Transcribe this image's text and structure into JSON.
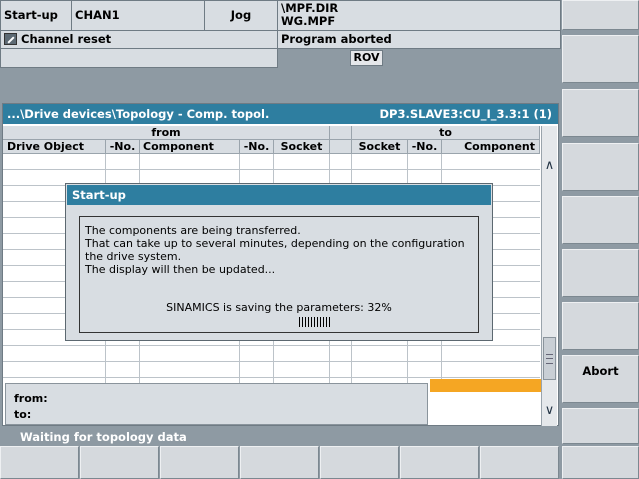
{
  "header": {
    "mode": "Start-up",
    "channel": "CHAN1",
    "op_mode": "Jog",
    "program_path": "\\MPF.DIR",
    "program_name": "WG.MPF",
    "channel_status": "Channel reset",
    "program_status": "Program aborted",
    "rov_label": "ROV"
  },
  "window": {
    "title": "...\\Drive devices\\Topology - Comp. topol.",
    "device": "DP3.SLAVE3:CU_I_3.3:1 (1)"
  },
  "table": {
    "group_from": "from",
    "group_to": "to",
    "columns": [
      "Drive Object",
      "-No.",
      "Component",
      "-No.",
      "Socket",
      "",
      "Socket",
      "-No.",
      "Component"
    ],
    "from_label": "from:",
    "to_label": "to:"
  },
  "dialog": {
    "title": "Start-up",
    "lines": [
      "The components are being transferred.",
      "That can take up to several minutes, depending on the configuration",
      "the drive system.",
      "The display will then be updated..."
    ],
    "progress_text": "SINAMICS is saving the parameters: 32%",
    "progress_value": 32
  },
  "softkeys": {
    "abort_label": "Abort"
  },
  "status": {
    "message": "Waiting for topology data"
  },
  "colors": {
    "titlebar": "#2e7ea0",
    "highlight": "#f5a623",
    "background": "#8e9aa3"
  }
}
